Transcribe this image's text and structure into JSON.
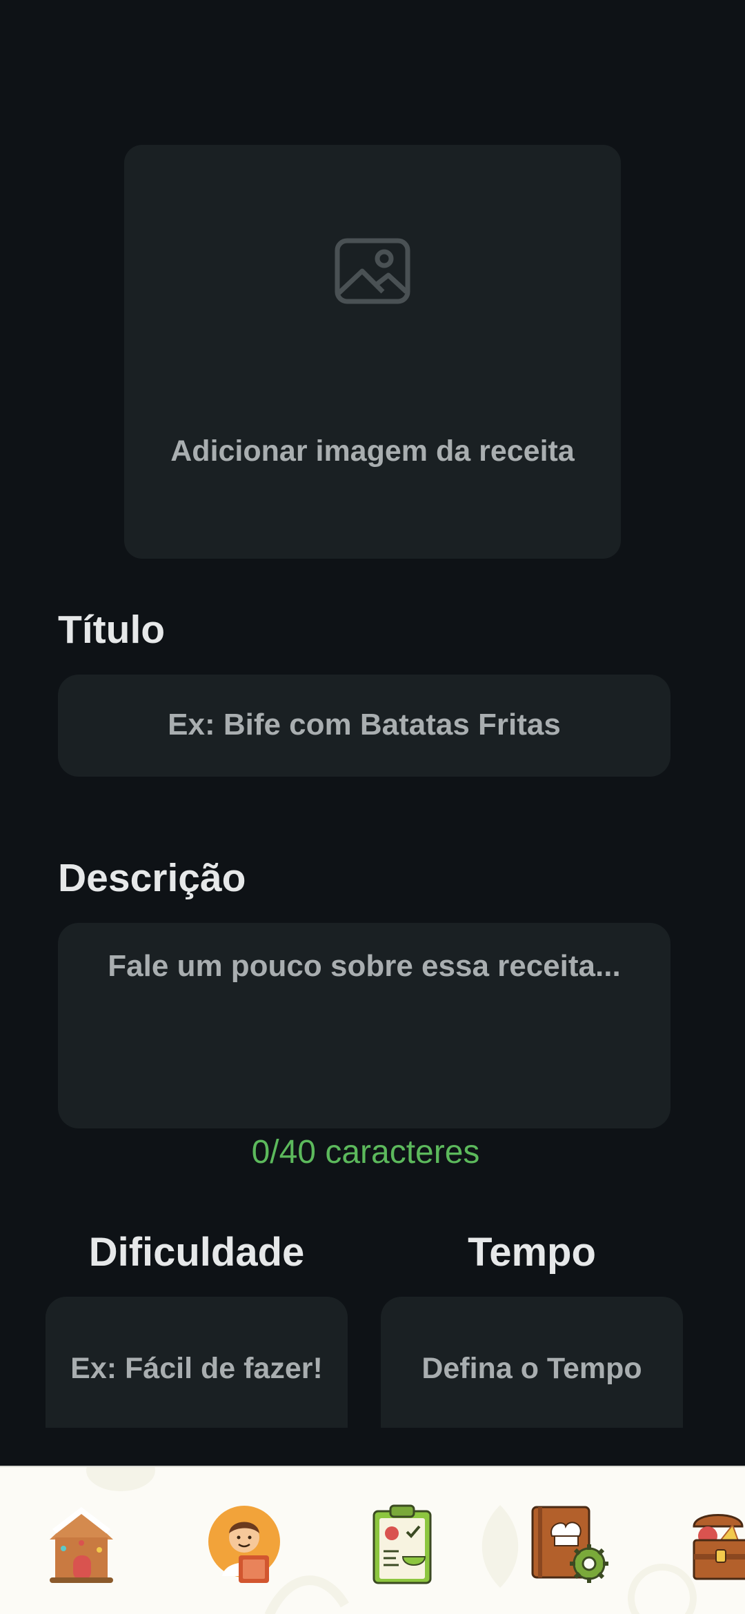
{
  "image_picker": {
    "label": "Adicionar imagem da receita",
    "icon": "image-placeholder-icon"
  },
  "title_field": {
    "label": "Título",
    "placeholder": "Ex: Bife com Batatas Fritas"
  },
  "description_field": {
    "label": "Descrição",
    "placeholder": "Fale um pouco sobre essa receita...",
    "char_count": "0/40 caracteres"
  },
  "difficulty_field": {
    "label": "Dificuldade",
    "placeholder": "Ex: Fácil de fazer!"
  },
  "time_field": {
    "label": "Tempo",
    "placeholder": "Defina o Tempo"
  },
  "bottom_nav": {
    "items": [
      {
        "icon": "gingerbread-house-icon"
      },
      {
        "icon": "chef-avatar-with-book-icon"
      },
      {
        "icon": "meal-plan-clipboard-icon"
      },
      {
        "icon": "recipe-book-settings-icon"
      },
      {
        "icon": "food-treasure-chest-icon"
      }
    ]
  },
  "colors": {
    "background": "#0e1216",
    "field": "#1a2023",
    "accent_green": "#5cb95c",
    "nav_bg": "#fcfbf6"
  }
}
